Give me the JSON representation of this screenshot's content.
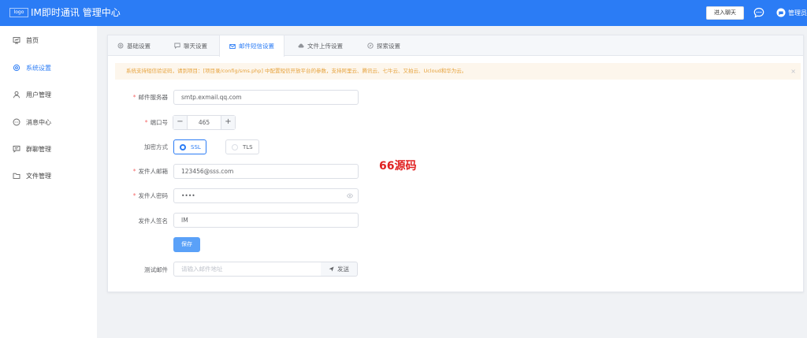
{
  "header": {
    "logo_alt": "logo",
    "app_title": "IM即时通讯 管理中心",
    "enter_chat": "进入聊天",
    "admin_name": "管理员"
  },
  "sidebar": {
    "items": [
      {
        "label": "首页",
        "icon": "dashboard-icon"
      },
      {
        "label": "系统设置",
        "icon": "gear-icon",
        "active": true
      },
      {
        "label": "用户管理",
        "icon": "user-icon"
      },
      {
        "label": "消息中心",
        "icon": "message-icon"
      },
      {
        "label": "群聊管理",
        "icon": "group-chat-icon"
      },
      {
        "label": "文件管理",
        "icon": "folder-icon"
      }
    ]
  },
  "tabs": [
    {
      "label": "基础设置",
      "icon": "gear-icon"
    },
    {
      "label": "聊天设置",
      "icon": "chat-icon"
    },
    {
      "label": "邮件短信设置",
      "icon": "mail-icon",
      "active": true
    },
    {
      "label": "文件上传设置",
      "icon": "upload-cloud-icon"
    },
    {
      "label": "探索设置",
      "icon": "compass-icon"
    }
  ],
  "alert": {
    "text": "系统支持短信验证码，请到项目：[项目录/config/sms.php] 中配置短信开放平台的参数，支持阿里云、腾讯云、七牛云、又拍云、Ucloud和华为云。",
    "close": "×"
  },
  "form": {
    "mail_server_label": "邮件服务器",
    "mail_server_value": "smtp.exmail.qq.com",
    "port_label": "端口号",
    "port_value": "465",
    "port_minus": "−",
    "port_plus": "+",
    "encryption_label": "加密方式",
    "encryption_options": [
      "SSL",
      "TLS"
    ],
    "encryption_selected": "SSL",
    "sender_email_label": "发件人邮箱",
    "sender_email_value": "123456@sss.com",
    "sender_password_label": "发件人密码",
    "sender_password_value": "••••",
    "sender_sign_label": "发件人签名",
    "sender_sign_value": "IM",
    "save_label": "保存",
    "test_mail_label": "测试邮件",
    "test_mail_placeholder": "请输入邮件地址",
    "send_label": "发送",
    "required_mark": "*"
  },
  "watermark": "66源码",
  "colors": {
    "primary": "#2b7cf5",
    "alert_text": "#e6a23c",
    "alert_bg": "#fdf6ec",
    "required": "#f56c6c",
    "watermark": "#e02020"
  }
}
